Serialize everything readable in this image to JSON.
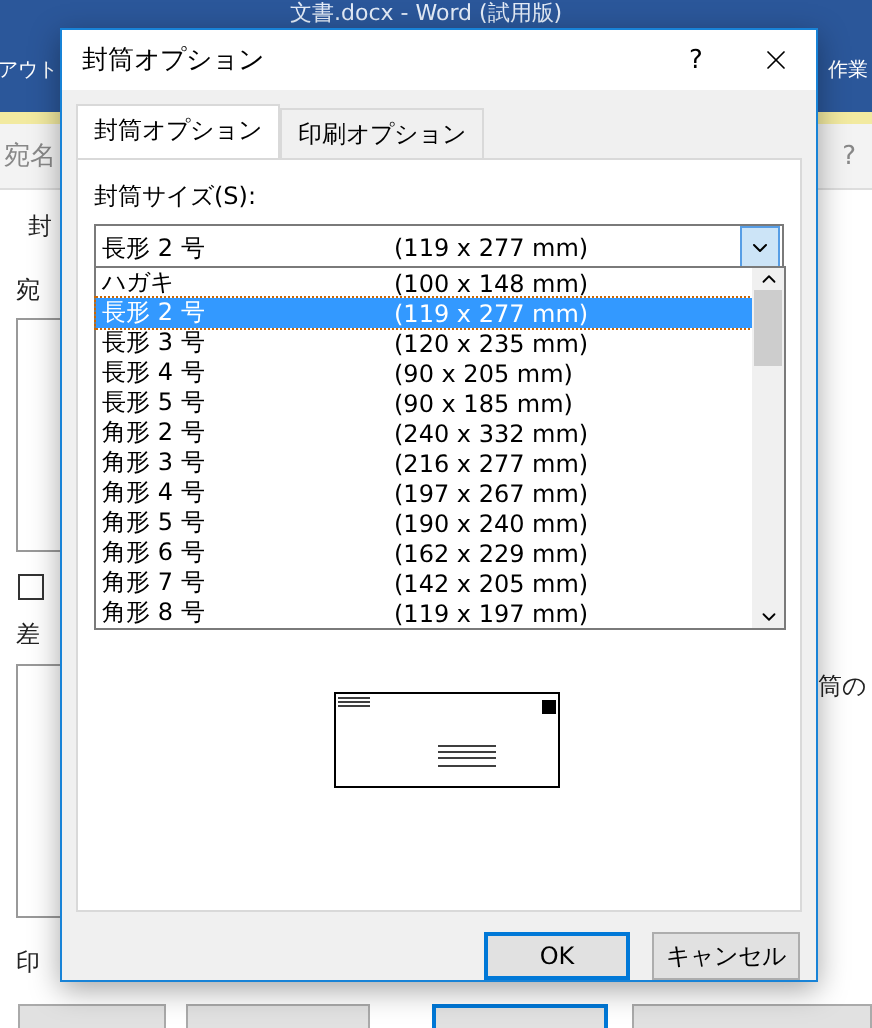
{
  "background_window": {
    "title": "文書.docx - Word (試用版)",
    "ribbon_left": "アウト",
    "ribbon_right": "作業",
    "tab_label": "宛名",
    "help": "?",
    "left_labels": [
      "封",
      "宛"
    ],
    "checkbox_checked": false,
    "sender_label": "差",
    "right_label": "筒の",
    "print_label": "印",
    "buttons": [
      {
        "default": false
      },
      {
        "default": false
      },
      {
        "default": true
      },
      {
        "default": false
      }
    ]
  },
  "dialog": {
    "title": "封筒オプション",
    "help": "?",
    "tabs": [
      {
        "label": "封筒オプション",
        "selected": true
      },
      {
        "label": "印刷オプション",
        "selected": false
      }
    ],
    "size_label": "封筒サイズ(S):",
    "combo": {
      "name": "長形 2 号",
      "size": "(119 x 277 mm)"
    },
    "options": [
      {
        "name": "ハガキ",
        "size": "(100 x 148 mm)",
        "selected": false
      },
      {
        "name": "長形 2 号",
        "size": "(119 x 277 mm)",
        "selected": true
      },
      {
        "name": "長形 3 号",
        "size": "(120 x 235 mm)",
        "selected": false
      },
      {
        "name": "長形 4 号",
        "size": "(90 x 205 mm)",
        "selected": false
      },
      {
        "name": "長形 5 号",
        "size": "(90 x 185 mm)",
        "selected": false
      },
      {
        "name": "角形 2 号",
        "size": "(240 x 332 mm)",
        "selected": false
      },
      {
        "name": "角形 3 号",
        "size": "(216 x 277 mm)",
        "selected": false
      },
      {
        "name": "角形 4 号",
        "size": "(197 x 267 mm)",
        "selected": false
      },
      {
        "name": "角形 5 号",
        "size": "(190 x 240 mm)",
        "selected": false
      },
      {
        "name": "角形 6 号",
        "size": "(162 x 229 mm)",
        "selected": false
      },
      {
        "name": "角形 7 号",
        "size": "(142 x 205 mm)",
        "selected": false
      },
      {
        "name": "角形 8 号",
        "size": "(119 x 197 mm)",
        "selected": false
      }
    ],
    "buttons": [
      "OK",
      "キャンセル"
    ]
  }
}
